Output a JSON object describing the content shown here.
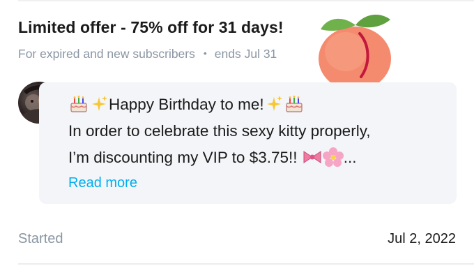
{
  "offer": {
    "title": "Limited offer - 75% off for 31 days!",
    "subtitle": "For expired and new subscribers",
    "separator": "•",
    "ends": "ends Jul 31"
  },
  "message": {
    "line1_text": "Happy Birthday to me!",
    "line2": "In order to celebrate this sexy kitty properly,",
    "line3_text": "I’m discounting my VIP to $3.75!!",
    "ellipsis": "...",
    "read_more": "Read more"
  },
  "footer": {
    "started_label": "Started",
    "started_date": "Jul 2, 2022"
  },
  "icons": [
    "peach-icon",
    "cake-icon",
    "sparkles-icon",
    "ribbon-icon",
    "cherry-blossom-icon",
    "avatar"
  ],
  "colors": {
    "link": "#00aeef",
    "muted": "#8a96a3",
    "text": "#1b1b1b",
    "message_bg": "#f3f5f8",
    "peach": "#f58b6f",
    "peach_stem": "#6fb24b"
  }
}
